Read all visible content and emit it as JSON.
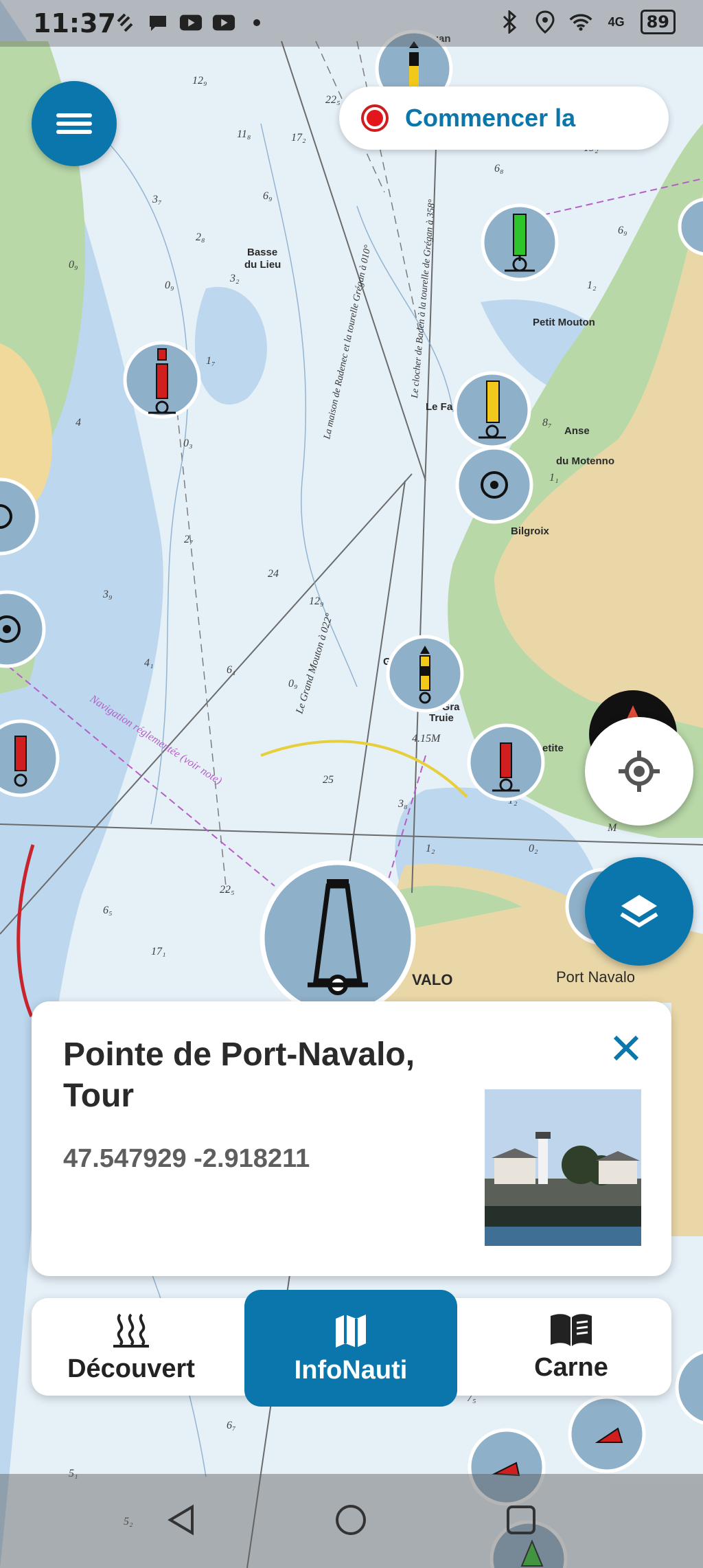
{
  "status_bar": {
    "time": "11:37",
    "battery": "89",
    "network": "4G"
  },
  "record": {
    "label": "Commencer la"
  },
  "map_labels": [
    "Grégan",
    "Basse du Lieu",
    "Petit Mouton",
    "Anse du Moteno",
    "Bilgroix",
    "Port Navalo",
    "Le Grand Mouton",
    "Grande Truie",
    "VALO",
    "Le Fa"
  ],
  "info_card": {
    "title": "Pointe de Port-Navalo, Tour",
    "coords": "47.547929 -2.918211"
  },
  "bottom_nav": {
    "items": [
      {
        "label": "Découvert",
        "icon": "tide-waves-icon"
      },
      {
        "label": "InfoNauti",
        "icon": "map-icon"
      },
      {
        "label": "Carne",
        "icon": "book-icon"
      }
    ]
  },
  "colors": {
    "accent": "#0b76ab",
    "land_green": "#b8d8a8",
    "land_sand": "#e9d7a8",
    "shallow_blue": "#bcd7ee",
    "record_red": "#e3161b",
    "buoy_red": "#d11f1f",
    "buoy_green": "#2ec52b",
    "buoy_yellow": "#f2c81a",
    "marker_bg": "#8fb0c9"
  }
}
